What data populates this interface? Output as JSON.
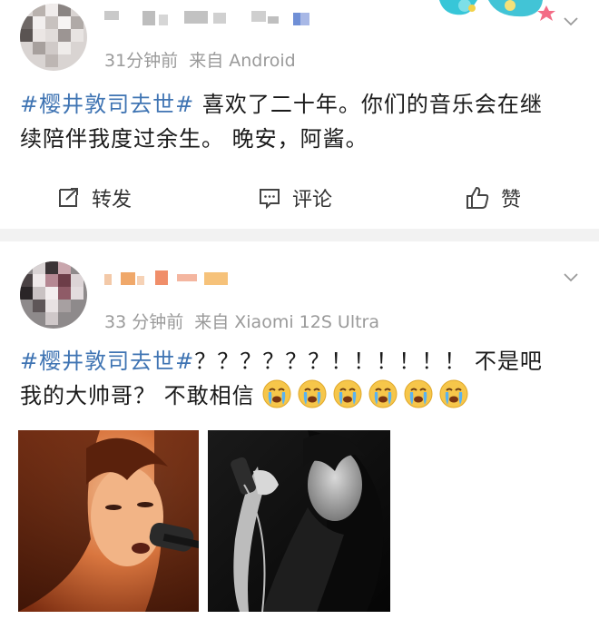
{
  "posts": [
    {
      "time": "31分钟前",
      "source": "来自 Android",
      "hashtag": "#樱井敦司去世#",
      "text_line1_rest": " 喜欢了二十年。你们的音乐会在继",
      "text_line2": "续陪伴我度过余生。 晚安，阿酱。",
      "actions": {
        "repost": "转发",
        "comment": "评论",
        "like": "赞"
      }
    },
    {
      "time": "33 分钟前",
      "source": "来自 Xiaomi 12S Ultra",
      "hashtag": "#樱井敦司去世#",
      "text_line1_rest": "？？？？？？！！！！！！ 不是吧",
      "text_line2": "我的大帅哥？ 不敢相信",
      "emoji_count": 6,
      "emoji_name": "crying-face-icon",
      "photos": [
        "photo-1",
        "photo-2"
      ]
    }
  ],
  "colors": {
    "hashtag": "#3f74b3",
    "meta": "#9a9a9a",
    "separator": "#f2f2f2",
    "text": "#1a1a1a"
  }
}
